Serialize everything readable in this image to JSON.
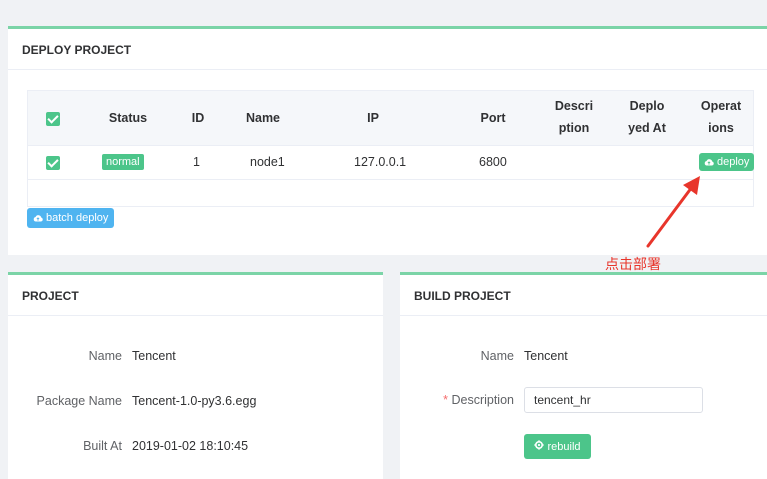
{
  "deploy": {
    "title": "DEPLOY PROJECT",
    "columns": {
      "status": "Status",
      "id": "ID",
      "name": "Name",
      "ip": "IP",
      "port": "Port",
      "description_1": "Descri",
      "description_2": "ption",
      "deployed_at_1": "Deplo",
      "deployed_at_2": "yed At",
      "operations_1": "Operat",
      "operations_2": "ions"
    },
    "rows": [
      {
        "status": "normal",
        "id": "1",
        "name": "node1",
        "ip": "127.0.0.1",
        "port": "6800",
        "description": "",
        "deployed_at": "",
        "action": "deploy"
      }
    ],
    "batch_label": "batch deploy",
    "annotation": "点击部署"
  },
  "project": {
    "title": "PROJECT",
    "name_label": "Name",
    "name_value": "Tencent",
    "package_label": "Package Name",
    "package_value": "Tencent-1.0-py3.6.egg",
    "built_label": "Built At",
    "built_value": "2019-01-02 18:10:45"
  },
  "build": {
    "title": "BUILD PROJECT",
    "name_label": "Name",
    "name_value": "Tencent",
    "description_required": "*",
    "description_label": "Description",
    "description_value": "tencent_hr",
    "rebuild_label": "rebuild"
  },
  "colors": {
    "accent": "#4cc58a",
    "info": "#4fb4f0",
    "annotation": "#e8352b"
  },
  "icons": {
    "deploy": "cloud-upload-icon",
    "batch": "cloud-upload-icon",
    "rebuild": "gear-icon"
  }
}
